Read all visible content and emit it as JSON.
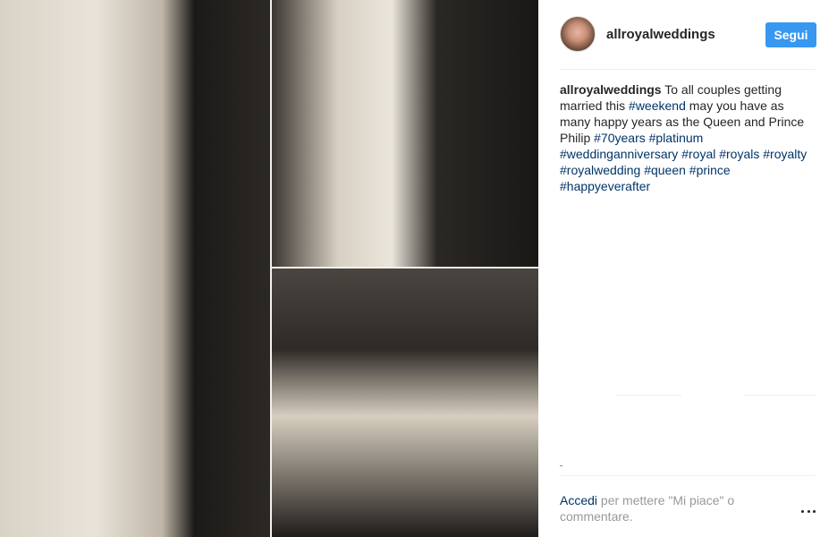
{
  "post": {
    "photo_alt": "",
    "username": "allroyalweddings"
  },
  "header": {
    "username": "allroyalweddings",
    "follow_label": "Segui"
  },
  "caption": {
    "username": "allroyalweddings",
    "text_1": "To all couples getting married this ",
    "tag_weekend": "#weekend",
    "text_2": " may you have as many happy years as the Queen and Prince Philip ",
    "tags": [
      "#70years",
      "#platinum",
      "#weddinganniversary",
      "#royal",
      "#royals",
      "#royalty",
      "#royalwedding",
      "#queen",
      "#prince",
      "#happyeverafter"
    ]
  },
  "footer": {
    "login_link": "Accedi",
    "login_rest": " per mettere \"Mi piace\" o commentare.",
    "more_icon": "more-options-icon"
  },
  "colors": {
    "follow_button": "#3897f0",
    "link": "#003569",
    "muted": "#999999",
    "text": "#262626"
  }
}
